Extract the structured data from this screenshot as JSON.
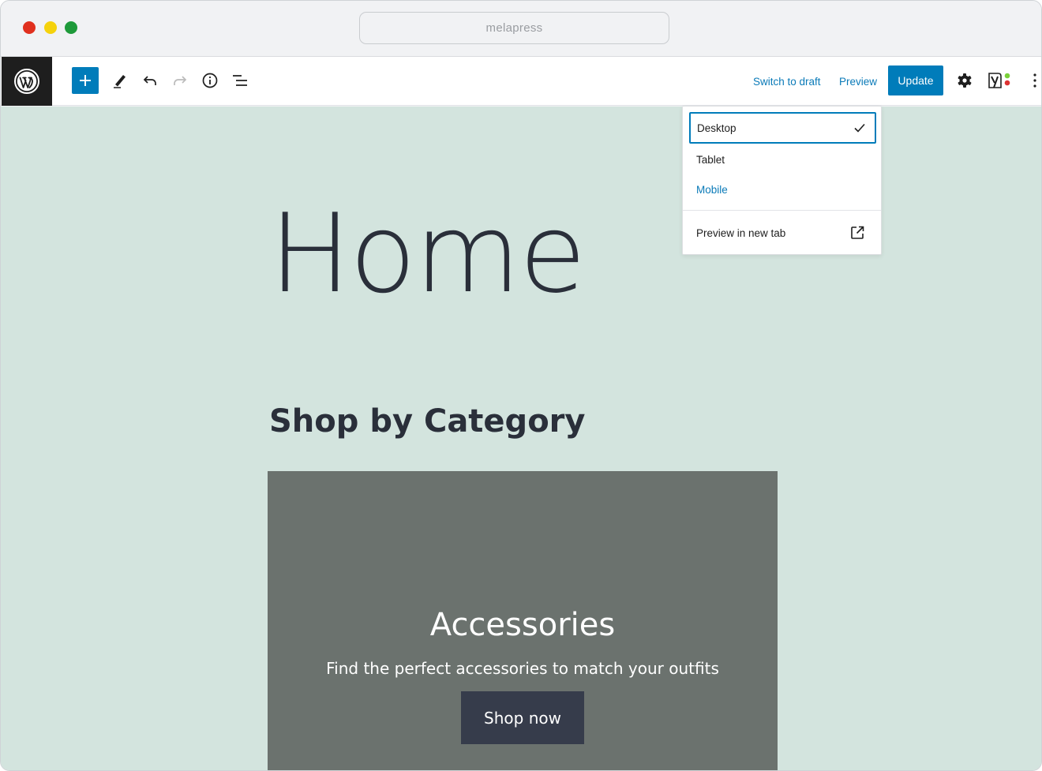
{
  "browser": {
    "url": "melapress"
  },
  "toolbar": {
    "switch_to_draft": "Switch to draft",
    "preview": "Preview",
    "update": "Update",
    "icons": [
      "wordpress-logo-icon",
      "plus-icon",
      "pencil-icon",
      "undo-icon",
      "redo-icon",
      "info-icon",
      "list-view-icon",
      "gear-icon",
      "yoast-icon",
      "more-vertical-icon"
    ]
  },
  "preview_menu": {
    "desktop": "Desktop",
    "tablet": "Tablet",
    "mobile": "Mobile",
    "selected": "Desktop",
    "preview_new_tab": "Preview in new tab"
  },
  "content": {
    "page_title": "Home",
    "section_heading": "Shop by Category",
    "cover": {
      "title": "Accessories",
      "text": "Find the perfect accessories to match your outfits",
      "button": "Shop now"
    }
  },
  "colors": {
    "accent": "#007cba",
    "canvas_background": "#d3e4de",
    "cover_background": "#6b726e",
    "cover_button": "#363c4b",
    "admin_dark": "#1e1e1e"
  }
}
